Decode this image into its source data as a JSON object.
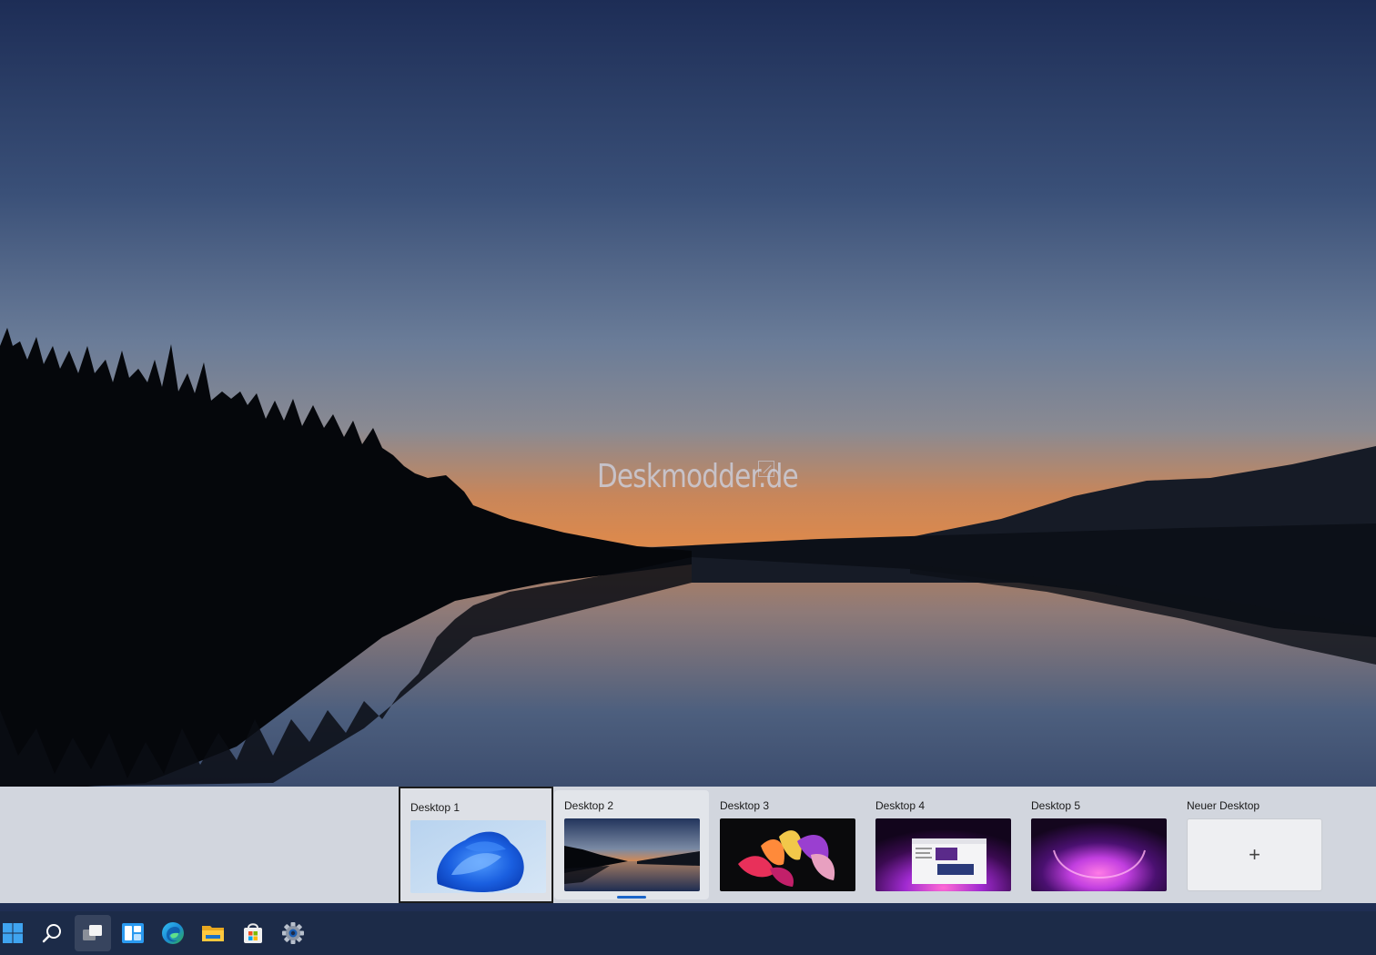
{
  "wallpaper": {
    "watermark": "Deskmodder.de"
  },
  "task_view": {
    "desktops": [
      {
        "label": "Desktop 1",
        "thumbnail": "windows-11-bloom-blue",
        "state": "selected"
      },
      {
        "label": "Desktop 2",
        "thumbnail": "lake-sunset",
        "state": "current"
      },
      {
        "label": "Desktop 3",
        "thumbnail": "colorful-ribbon-flower",
        "state": "normal"
      },
      {
        "label": "Desktop 4",
        "thumbnail": "purple-glow-with-window",
        "state": "normal"
      },
      {
        "label": "Desktop 5",
        "thumbnail": "purple-glow",
        "state": "normal"
      }
    ],
    "new_desktop": {
      "label": "Neuer Desktop",
      "icon": "plus-icon"
    }
  },
  "taskbar": {
    "items": [
      {
        "name": "start-button",
        "icon": "windows-logo-icon"
      },
      {
        "name": "search-button",
        "icon": "search-icon"
      },
      {
        "name": "task-view-button",
        "icon": "task-view-icon",
        "active": true
      },
      {
        "name": "widgets-button",
        "icon": "widgets-icon"
      },
      {
        "name": "edge-button",
        "icon": "edge-icon"
      },
      {
        "name": "file-explorer-button",
        "icon": "folder-icon"
      },
      {
        "name": "store-button",
        "icon": "store-icon"
      },
      {
        "name": "settings-button",
        "icon": "gear-icon"
      }
    ]
  },
  "colors": {
    "taskbar_bg": "#1c2b48",
    "strip_bg": "#d2d6de",
    "accent": "#1a64c8"
  }
}
